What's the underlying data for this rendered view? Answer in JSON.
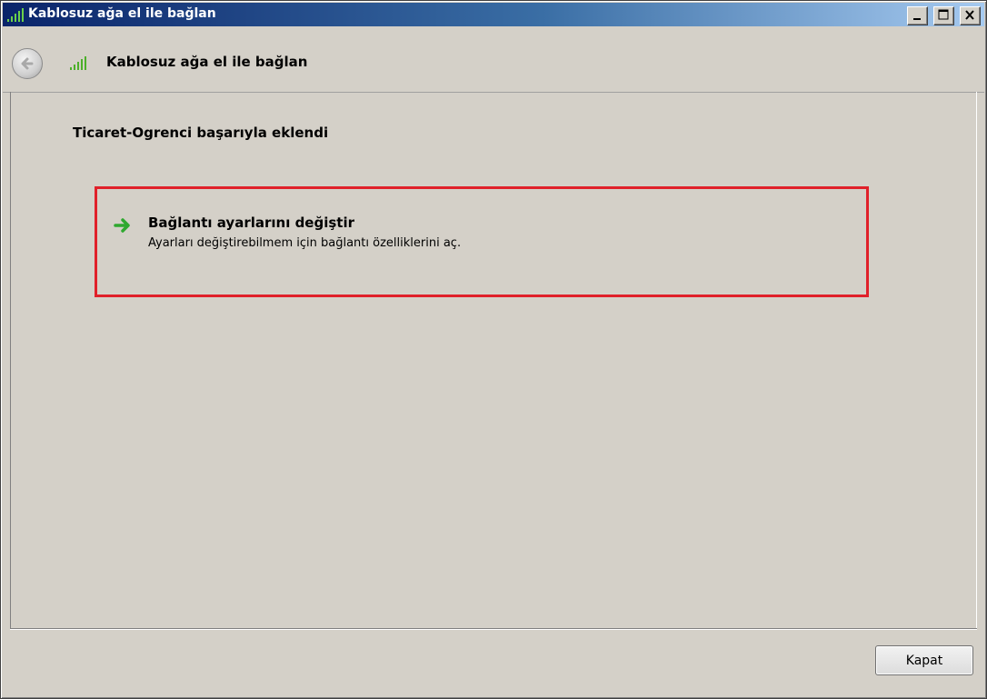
{
  "window": {
    "title": "Kablosuz ağa el ile bağlan",
    "minimize_icon": "minimize-icon",
    "maximize_icon": "maximize-icon",
    "close_icon": "close-icon"
  },
  "header": {
    "title": "Kablosuz ağa el ile bağlan",
    "back_icon": "back-arrow-icon",
    "network_icon": "wireless-signal-icon"
  },
  "content": {
    "success_message": "Ticaret-Ogrenci başarıyla eklendi",
    "option": {
      "icon": "green-arrow-icon",
      "title": "Bağlantı ayarlarını değiştir",
      "description": "Ayarları değiştirebilmem için bağlantı özelliklerini aç."
    },
    "highlight_color": "#e0202a"
  },
  "footer": {
    "close_label": "Kapat"
  }
}
